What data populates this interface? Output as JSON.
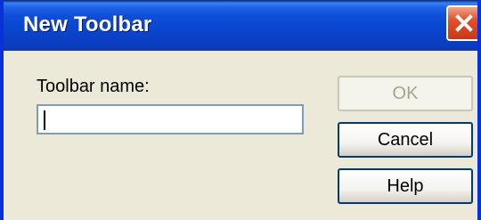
{
  "window": {
    "title": "New Toolbar",
    "close_icon": "close-icon"
  },
  "form": {
    "name_label": "Toolbar name:",
    "name_value": ""
  },
  "buttons": {
    "ok_label": "OK",
    "cancel_label": "Cancel",
    "help_label": "Help"
  },
  "colors": {
    "titlebar": "#0a46d0",
    "dialog_bg": "#ece9d8",
    "close_button": "#e0502a",
    "disabled_text": "#a5a293"
  }
}
